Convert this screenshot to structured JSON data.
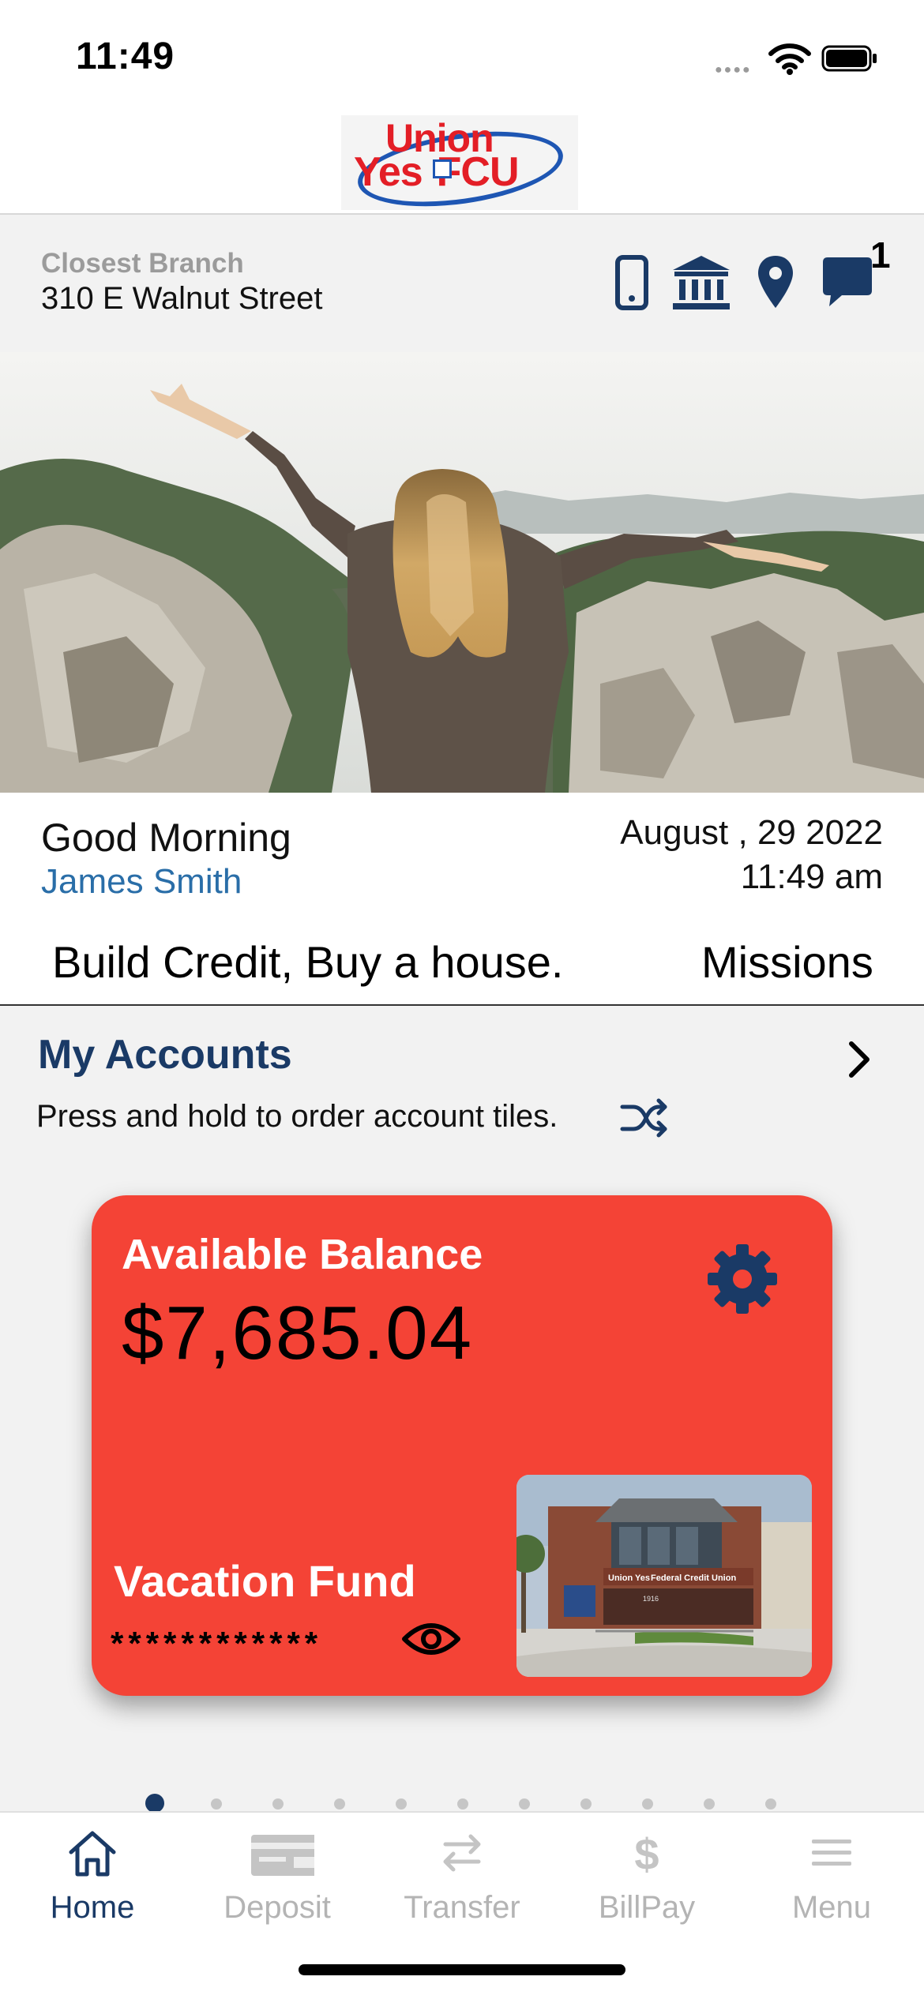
{
  "status_bar": {
    "time": "11:49",
    "signal_icon": "cellular-dots-icon",
    "wifi_icon": "wifi-icon",
    "battery_icon": "battery-full-icon"
  },
  "header": {
    "logo_line1": "Union",
    "logo_line2": "Yes",
    "logo_line3": "FCU",
    "logo_colors": {
      "red": "#e31e26",
      "blue": "#1e56b3"
    }
  },
  "branch": {
    "label": "Closest Branch",
    "address": "310 E Walnut Street",
    "icons": [
      "mobile-phone-icon",
      "bank-icon",
      "location-pin-icon",
      "chat-bubble-icon"
    ],
    "message_count": "1"
  },
  "hero": {
    "image": "woman-arms-outstretched-canyon-photo"
  },
  "greeting": {
    "salutation": "Good Morning",
    "name": "James Smith",
    "date": "August , 29 2022",
    "time": "11:49 am"
  },
  "promo_tabs": [
    "Build Credit, Buy a house.",
    "Missions"
  ],
  "accounts": {
    "title": "My Accounts",
    "hint": "Press and hold to order account tiles.",
    "chevron_icon": "chevron-right-icon",
    "shuffle_icon": "shuffle-icon",
    "card": {
      "balance_label": "Available Balance",
      "balance": "$7,685.04",
      "account_name": "Vacation Fund",
      "masked_number": "************",
      "gear_icon": "gear-icon",
      "eye_icon": "eye-icon",
      "card_color": "#f44336",
      "branch_photo": "union-yes-federal-credit-union-building-photo",
      "building_sign_left": "Union Yes",
      "building_sign_right": "Federal Credit Union",
      "building_number": "1916"
    },
    "pager": {
      "count": 11,
      "active_index": 0
    }
  },
  "tab_bar": {
    "tabs": [
      {
        "label": "Home",
        "icon": "home-icon",
        "active": true
      },
      {
        "label": "Deposit",
        "icon": "check-deposit-icon",
        "active": false
      },
      {
        "label": "Transfer",
        "icon": "transfer-arrows-icon",
        "active": false
      },
      {
        "label": "BillPay",
        "icon": "dollar-icon",
        "active": false
      },
      {
        "label": "Menu",
        "icon": "hamburger-menu-icon",
        "active": false
      }
    ],
    "active_color": "#1a3a66",
    "inactive_color": "#b4b4b4"
  }
}
